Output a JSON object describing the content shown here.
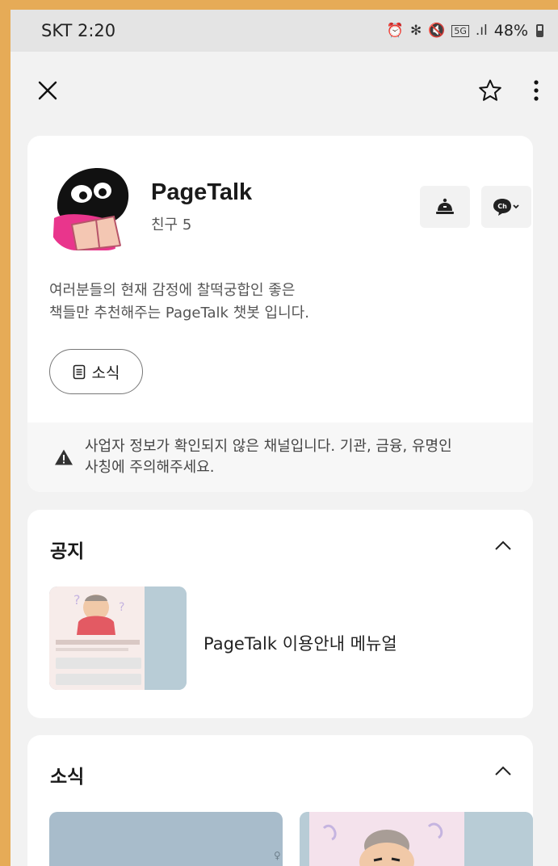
{
  "status_bar": {
    "carrier_time": "SKT 2:20",
    "network": "5G",
    "battery": "48%"
  },
  "header": {
    "close_icon": "close-icon",
    "star_icon": "star-icon",
    "more_icon": "more-vertical-icon"
  },
  "profile": {
    "name": "PageTalk",
    "friends": "친구 5",
    "description_line1": "여러분들의 현재 감정에 찰떡궁합인 좋은",
    "description_line2": "책들만 추천해주는 PageTalk 챗봇 입니다.",
    "news_button": "소식",
    "warning": "사업자 정보가 확인되지 않은 채널입니다. 기관, 금융, 유명인 사칭에 주의해주세요.",
    "warning_line1": "사업자 정보가 확인되지 않은 채널입니다. 기관, 금융, 유명인",
    "warning_line2": "사칭에 주의해주세요."
  },
  "notice": {
    "title": "공지",
    "items": [
      {
        "title": "PageTalk 이용안내 메뉴얼"
      }
    ]
  },
  "news": {
    "title": "소식"
  },
  "colors": {
    "frame": "#e6ab57",
    "background": "#f2f2f2",
    "card": "#ffffff"
  }
}
